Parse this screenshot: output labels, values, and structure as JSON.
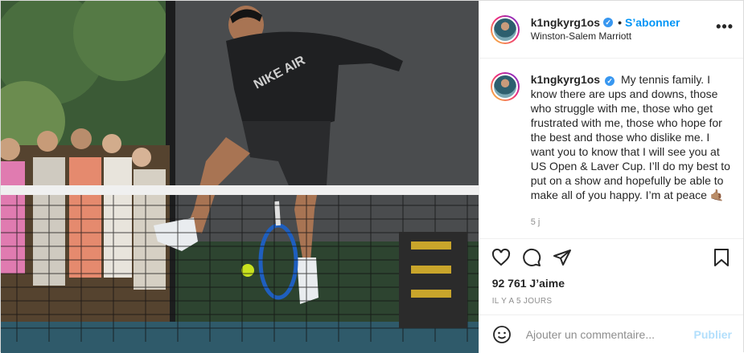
{
  "post": {
    "username": "k1ngkyrg1os",
    "follow_label": "S’abonner",
    "location": "Winston-Salem Marriott",
    "more_icon": "more-horizontal-icon",
    "photo_alt": "Tennis player jumping while hitting a ball between his legs near the net, spectators watching"
  },
  "caption": {
    "username": "k1ngkyrg1os",
    "text": "My tennis family. I know there are ups and downs, those who struggle with me, those who get frustrated with me, those who hope for the best and those who dislike me. I want you to know that I will see you at US Open & Laver Cup. I’ll do my best to put on a show and hopefully be able to make all of you happy. I’m at peace 🤙🏽",
    "time": "5 j"
  },
  "actions": {
    "icons": [
      "heart-icon",
      "comment-icon",
      "share-icon",
      "bookmark-icon"
    ]
  },
  "likes": "92 761 J’aime",
  "posted_ago": "IL Y A 5 JOURS",
  "comment_box": {
    "placeholder": "Ajouter un commentaire...",
    "publish_label": "Publier"
  },
  "colors": {
    "accent": "#0095f6",
    "verified": "#3897f0",
    "publish_disabled": "#b2dffc",
    "muted": "#8e8e8e"
  }
}
